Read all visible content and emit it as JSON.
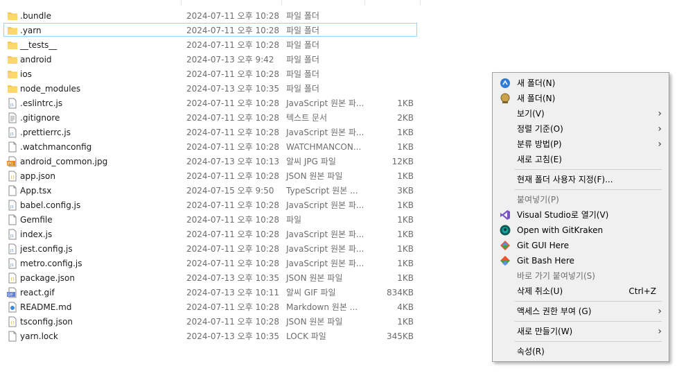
{
  "files": [
    {
      "name": ".bundle",
      "date": "2024-07-11 오후 10:28",
      "type": "파일 폴더",
      "size": "",
      "icon": "folder-icon",
      "selected": false
    },
    {
      "name": ".yarn",
      "date": "2024-07-11 오후 10:28",
      "type": "파일 폴더",
      "size": "",
      "icon": "folder-icon",
      "selected": true
    },
    {
      "name": "__tests__",
      "date": "2024-07-11 오후 10:28",
      "type": "파일 폴더",
      "size": "",
      "icon": "folder-icon",
      "selected": false
    },
    {
      "name": "android",
      "date": "2024-07-13 오후 9:42",
      "type": "파일 폴더",
      "size": "",
      "icon": "folder-icon",
      "selected": false
    },
    {
      "name": "ios",
      "date": "2024-07-11 오후 10:28",
      "type": "파일 폴더",
      "size": "",
      "icon": "folder-icon",
      "selected": false
    },
    {
      "name": "node_modules",
      "date": "2024-07-13 오후 10:35",
      "type": "파일 폴더",
      "size": "",
      "icon": "folder-icon",
      "selected": false
    },
    {
      "name": ".eslintrc.js",
      "date": "2024-07-11 오후 10:28",
      "type": "JavaScript 원본 파...",
      "size": "1KB",
      "icon": "js-file-icon",
      "selected": false
    },
    {
      "name": ".gitignore",
      "date": "2024-07-11 오후 10:28",
      "type": "텍스트 문서",
      "size": "2KB",
      "icon": "text-file-icon",
      "selected": false
    },
    {
      "name": ".prettierrc.js",
      "date": "2024-07-11 오후 10:28",
      "type": "JavaScript 원본 파...",
      "size": "1KB",
      "icon": "js-file-icon",
      "selected": false
    },
    {
      "name": ".watchmanconfig",
      "date": "2024-07-11 오후 10:28",
      "type": "WATCHMANCON...",
      "size": "1KB",
      "icon": "blank-file-icon",
      "selected": false
    },
    {
      "name": "android_common.jpg",
      "date": "2024-07-13 오후 10:13",
      "type": "알씨 JPG 파일",
      "size": "12KB",
      "icon": "jpg-file-icon",
      "selected": false
    },
    {
      "name": "app.json",
      "date": "2024-07-11 오후 10:28",
      "type": "JSON 원본 파일",
      "size": "1KB",
      "icon": "json-file-icon",
      "selected": false
    },
    {
      "name": "App.tsx",
      "date": "2024-07-15 오후 9:50",
      "type": "TypeScript 원본 ...",
      "size": "3KB",
      "icon": "blank-file-icon",
      "selected": false
    },
    {
      "name": "babel.config.js",
      "date": "2024-07-11 오후 10:28",
      "type": "JavaScript 원본 파...",
      "size": "1KB",
      "icon": "js-file-icon",
      "selected": false
    },
    {
      "name": "Gemfile",
      "date": "2024-07-11 오후 10:28",
      "type": "파일",
      "size": "1KB",
      "icon": "blank-file-icon",
      "selected": false
    },
    {
      "name": "index.js",
      "date": "2024-07-11 오후 10:28",
      "type": "JavaScript 원본 파...",
      "size": "1KB",
      "icon": "js-file-icon",
      "selected": false
    },
    {
      "name": "jest.config.js",
      "date": "2024-07-11 오후 10:28",
      "type": "JavaScript 원본 파...",
      "size": "1KB",
      "icon": "js-file-icon",
      "selected": false
    },
    {
      "name": "metro.config.js",
      "date": "2024-07-11 오후 10:28",
      "type": "JavaScript 원본 파...",
      "size": "1KB",
      "icon": "js-file-icon",
      "selected": false
    },
    {
      "name": "package.json",
      "date": "2024-07-13 오후 10:35",
      "type": "JSON 원본 파일",
      "size": "1KB",
      "icon": "json-file-icon",
      "selected": false
    },
    {
      "name": "react.gif",
      "date": "2024-07-13 오후 10:11",
      "type": "알씨 GIF 파일",
      "size": "834KB",
      "icon": "gif-file-icon",
      "selected": false
    },
    {
      "name": "README.md",
      "date": "2024-07-11 오후 10:28",
      "type": "Markdown 원본 ...",
      "size": "4KB",
      "icon": "md-file-icon",
      "selected": false
    },
    {
      "name": "tsconfig.json",
      "date": "2024-07-11 오후 10:28",
      "type": "JSON 원본 파일",
      "size": "1KB",
      "icon": "json-file-icon",
      "selected": false
    },
    {
      "name": "yarn.lock",
      "date": "2024-07-13 오후 10:35",
      "type": "LOCK 파일",
      "size": "345KB",
      "icon": "blank-file-icon",
      "selected": false
    }
  ],
  "context_menu": [
    {
      "label": "새 폴더(N)",
      "icon": "new-folder-blue-icon",
      "enabled": true,
      "submenu": false,
      "shortcut": ""
    },
    {
      "label": "새 폴더(N)",
      "icon": "new-folder-gold-icon",
      "enabled": true,
      "submenu": false,
      "shortcut": ""
    },
    {
      "label": "보기(V)",
      "icon": "",
      "enabled": true,
      "submenu": true,
      "shortcut": ""
    },
    {
      "label": "정렬 기준(O)",
      "icon": "",
      "enabled": true,
      "submenu": true,
      "shortcut": ""
    },
    {
      "label": "분류 방법(P)",
      "icon": "",
      "enabled": true,
      "submenu": true,
      "shortcut": ""
    },
    {
      "label": "새로 고침(E)",
      "icon": "",
      "enabled": true,
      "submenu": false,
      "shortcut": ""
    },
    {
      "separator": true
    },
    {
      "label": "현재 폴더 사용자 지정(F)...",
      "icon": "",
      "enabled": true,
      "submenu": false,
      "shortcut": ""
    },
    {
      "separator": true
    },
    {
      "label": "붙여넣기(P)",
      "icon": "",
      "enabled": false,
      "submenu": false,
      "shortcut": ""
    },
    {
      "label": "Visual Studio로 열기(V)",
      "icon": "visual-studio-icon",
      "enabled": true,
      "submenu": false,
      "shortcut": ""
    },
    {
      "label": "Open with GitKraken",
      "icon": "gitkraken-icon",
      "enabled": true,
      "submenu": false,
      "shortcut": ""
    },
    {
      "label": "Git GUI Here",
      "icon": "git-gui-icon",
      "enabled": true,
      "submenu": false,
      "shortcut": ""
    },
    {
      "label": "Git Bash Here",
      "icon": "git-bash-icon",
      "enabled": true,
      "submenu": false,
      "shortcut": ""
    },
    {
      "label": "바로 가기 붙여넣기(S)",
      "icon": "",
      "enabled": false,
      "submenu": false,
      "shortcut": ""
    },
    {
      "label": "삭제 취소(U)",
      "icon": "",
      "enabled": true,
      "submenu": false,
      "shortcut": "Ctrl+Z"
    },
    {
      "separator": true
    },
    {
      "label": "액세스 권한 부여 (G)",
      "icon": "",
      "enabled": true,
      "submenu": true,
      "shortcut": ""
    },
    {
      "separator": true
    },
    {
      "label": "새로 만들기(W)",
      "icon": "",
      "enabled": true,
      "submenu": true,
      "shortcut": ""
    },
    {
      "separator": true
    },
    {
      "label": "속성(R)",
      "icon": "",
      "enabled": true,
      "submenu": false,
      "shortcut": ""
    }
  ],
  "colors": {
    "folder": "#f8c94c",
    "selection_border": "#99d1ff",
    "menu_background": "#f0f0f0",
    "secondary_text": "#6d6d6d"
  }
}
